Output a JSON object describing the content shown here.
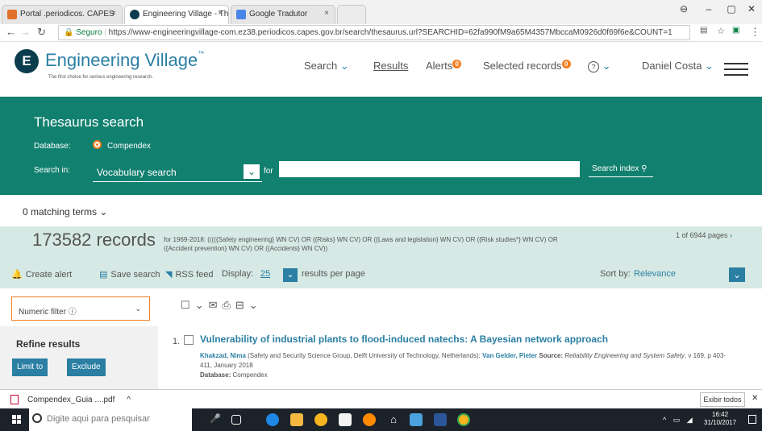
{
  "browser": {
    "tabs": [
      {
        "label": "Portal .periodicos. CAPES",
        "close": "×"
      },
      {
        "label": "Engineering Village - The",
        "close": "×"
      },
      {
        "label": "Google Tradutor",
        "close": "×"
      }
    ],
    "secure_label": "Seguro",
    "url": "https://www-engineeringvillage-com.ez38.periodicos.capes.gov.br/search/thesaurus.url?SEARCHID=62fa990fM9a65M4357MbccaM0926d0f69f6e&COUNT=1"
  },
  "header": {
    "logo_icon": "E",
    "logo_text": "Engineering Village",
    "logo_tm": "™",
    "tagline": "The first choice for serious engineering research.",
    "nav": {
      "search": "Search",
      "results": "Results",
      "alerts": "Alerts",
      "alerts_badge": "0",
      "selected": "Selected records",
      "selected_badge": "0",
      "help": "?",
      "user": "Daniel Costa"
    }
  },
  "thesaurus": {
    "title": "Thesaurus search",
    "database_label": "Database:",
    "database_value": "Compendex",
    "search_in_label": "Search in:",
    "search_in_value": "Vocabulary search",
    "for_label": "for",
    "term_value": "",
    "search_index_button": "Search index"
  },
  "matching_terms": "0 matching terms",
  "records": {
    "count": "173582 records",
    "query": "for 1969-2018: (((({Safety engineering} WN CV) OR ({Risks} WN CV) OR ({Laws and legislation} WN CV) OR ({Risk studies*} WN CV) OR ({Accident prevention} WN CV) OR ({Accidents} WN CV))",
    "pages": "1 of 6944 pages"
  },
  "toolbar": {
    "create_alert": "Create alert",
    "save_search": "Save search",
    "rss": "RSS feed",
    "display_label": "Display:",
    "display_value": "25",
    "per_page": "results per page",
    "sort_label": "Sort by:",
    "sort_value": "Relevance"
  },
  "filters": {
    "numeric_filter": "Numeric filter",
    "refine_title": "Refine results",
    "limit_button": "Limit to",
    "exclude_button": "Exclude"
  },
  "results": [
    {
      "number": "1.",
      "title": "Vulnerability of industrial plants to flood-induced natechs: A Bayesian network approach",
      "author1": "Khakzad, Nima",
      "affil1": " (Safety and Security Science Group, Delft University of Technology, Netherlands); ",
      "author2": "Van Gelder, Pieter",
      "source_label": " Source: ",
      "source": "Reliability Engineering and System Safety",
      "details": ", v 169, p 403-411, January 2018",
      "database_label": "Database:",
      "database": "Compendex"
    }
  ],
  "downloads": {
    "file": "Compendex_Guia ....pdf",
    "show_all": "Exibir todos"
  },
  "taskbar": {
    "search_placeholder": "Digite aqui para pesquisar",
    "time": "16:42",
    "date": "31/10/2017"
  }
}
